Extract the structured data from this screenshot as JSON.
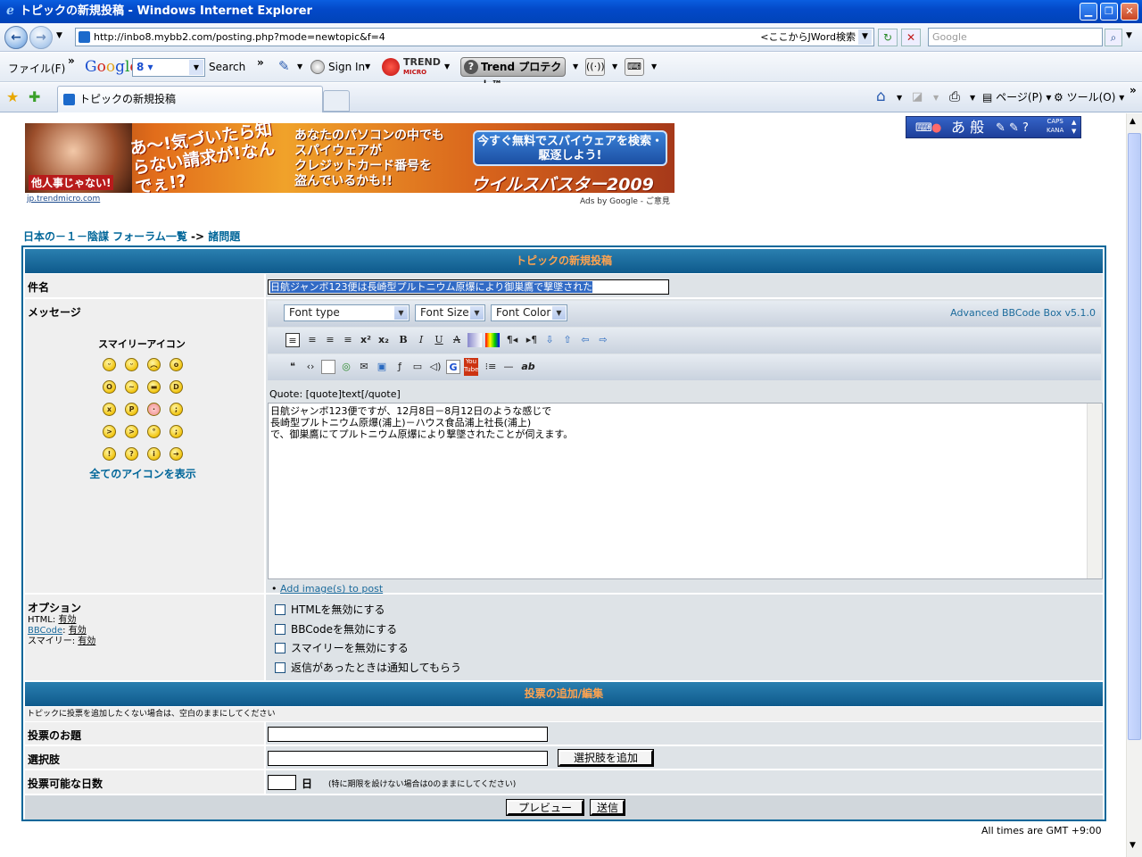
{
  "window": {
    "title": "トピックの新規投稿 - Windows Internet Explorer"
  },
  "address": {
    "url": "http://inbo8.mybb2.com/posting.php?mode=newtopic&f=4",
    "jword": "<ここからJWord検索",
    "search_placeholder": "Google"
  },
  "toolbar": {
    "menu_file": "ファイル(F)",
    "google": "Google",
    "google_select": "8 ▾",
    "search": "Search",
    "sign_in": "Sign In",
    "trend_brand": "TREND",
    "trend_sub": "MICRO",
    "trend_protect": "Trend プロテクト™"
  },
  "tabs": {
    "active_tab": "トピックの新規投稿",
    "page_menu": "ページ(P)",
    "tools_menu": "ツール(O)"
  },
  "ime": {
    "label": "あ 般",
    "caps": "CAPS",
    "kana": "KANA"
  },
  "ad": {
    "tag": "他人事じゃない!",
    "headline": "あ〜!気づいたら知らない請求が!なんでぇ!?",
    "body_lines": [
      "あなたのパソコンの中でも",
      "スパイウェアが",
      "クレジットカード番号を",
      "盗んでいるかも!!"
    ],
    "cta": "今すぐ無料でスパイウェアを検索・駆逐しよう!",
    "brand": "ウイルスバスター2009",
    "link": "jp.trendmicro.com",
    "ads_by": "Ads by Google - ご意見"
  },
  "breadcrumb": {
    "home": "日本の－１－陰謀 フォーラム一覧",
    "sep": "->",
    "forum": "諸問題"
  },
  "post_form": {
    "header": "トピックの新規投稿",
    "subject_label": "件名",
    "subject_value": "日航ジャンボ123便は長崎型プルトニウム原爆により御巣鷹で撃墜された",
    "message_label": "メッセージ",
    "smilies_title": "スマイリーアイコン",
    "smilies_more": "全てのアイコンを表示",
    "font_type": "Font type",
    "font_size": "Font Size",
    "font_color": "Font Color",
    "bbcode_version": "Advanced BBCode Box v5.1.0",
    "quote_hint": "Quote: [quote]text[/quote]",
    "message_lines": [
      "日航ジャンボ123便ですが、12月8日－8月12日のような感じで",
      "長崎型プルトニウム原爆(浦上)－ハウス食品浦上社長(浦上)",
      "で、御巣鷹にてプルトニウム原爆により撃墜されたことが伺えます。"
    ],
    "add_image": "Add image(s) to post",
    "options_label": "オプション",
    "html_status_label": "HTML:",
    "html_status": "有効",
    "bbcode_label": "BBCode",
    "bbcode_status": "有効",
    "smiley_status_label": "スマイリー:",
    "smiley_status": "有効",
    "options": [
      "HTMLを無効にする",
      "BBCodeを無効にする",
      "スマイリーを無効にする",
      "返信があったときは通知してもらう"
    ]
  },
  "poll": {
    "header": "投票の追加/編集",
    "note": "トピックに投票を追加したくない場合は、空白のままにしてください",
    "question_label": "投票のお題",
    "option_label": "選択肢",
    "add_option_button": "選択肢を追加",
    "days_label": "投票可能な日数",
    "days_unit": "日",
    "days_note": "(特に期限を設けない場合は0のままにしてください)"
  },
  "actions": {
    "preview": "プレビュー",
    "submit": "送信"
  },
  "footer": {
    "timezone": "All times are GMT +9:00"
  },
  "colors": {
    "accent": "#006699",
    "header_text": "#ffa34f",
    "titlebar": "#0349c8"
  }
}
